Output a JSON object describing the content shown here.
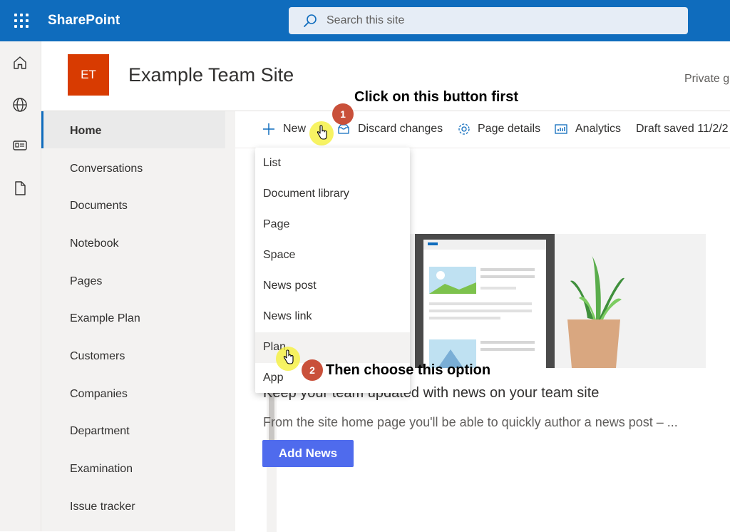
{
  "app": {
    "name": "SharePoint",
    "search_placeholder": "Search this site"
  },
  "site": {
    "logo_text": "ET",
    "title": "Example Team Site",
    "privacy": "Private g"
  },
  "left_nav": {
    "items": [
      {
        "label": "Home",
        "active": true
      },
      {
        "label": "Conversations"
      },
      {
        "label": "Documents"
      },
      {
        "label": "Notebook"
      },
      {
        "label": "Pages"
      },
      {
        "label": "Example Plan"
      },
      {
        "label": "Customers"
      },
      {
        "label": "Companies"
      },
      {
        "label": "Department"
      },
      {
        "label": "Examination"
      },
      {
        "label": "Issue tracker"
      }
    ]
  },
  "command_bar": {
    "new_label": "New",
    "discard_label": "Discard changes",
    "page_details_label": "Page details",
    "analytics_label": "Analytics",
    "draft_status": "Draft saved 11/2/2"
  },
  "new_menu": {
    "items": [
      "List",
      "Document library",
      "Page",
      "Space",
      "News post",
      "News link",
      "Plan",
      "App"
    ],
    "hovered": "Plan"
  },
  "annotations": {
    "step1_number": "1",
    "step1_text": "Click on this button first",
    "step2_number": "2",
    "step2_text": "Then choose this option"
  },
  "news": {
    "heading": "Keep your team updated with news on your team site",
    "description": "From the site home page you'll be able to quickly author a news post – ...",
    "add_button": "Add News"
  },
  "colors": {
    "suite_bar": "#0f6cbd",
    "logo": "#d83b01",
    "callout_badge": "#c9503a",
    "primary_button": "#4f6bed"
  }
}
